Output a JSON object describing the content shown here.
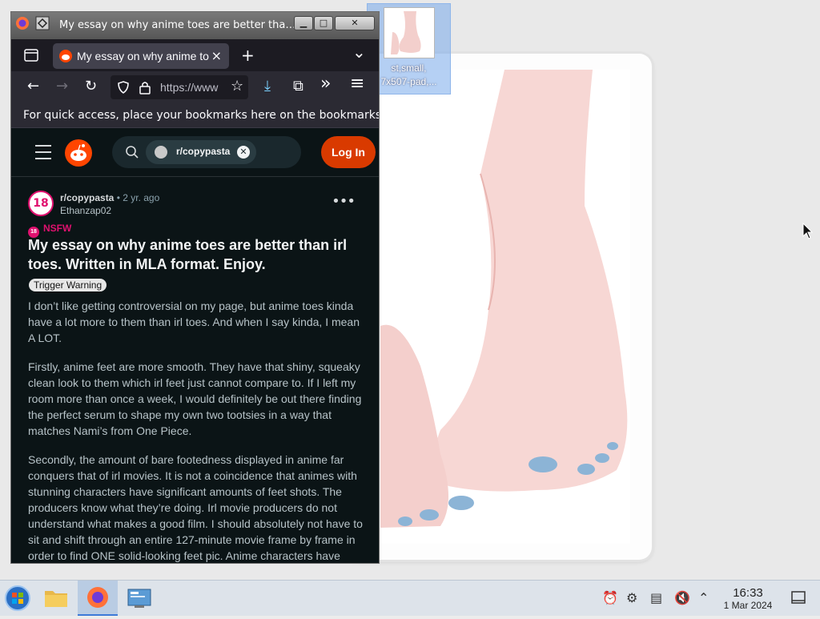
{
  "window": {
    "title": "My essay on why anime toes are better than ..."
  },
  "tab": {
    "label": "My essay on why anime toes",
    "close": "×",
    "new": "+",
    "list": "⌄"
  },
  "nav": {
    "back": "←",
    "forward": "→",
    "reload": "↻",
    "url": "https://www",
    "star": "☆",
    "download": "⤓",
    "extensions": "⧉",
    "overflow": "»",
    "menu": "≡"
  },
  "bookmarks_bar": {
    "text": "For quick access, place your bookmarks here on the bookmarks to"
  },
  "reddit": {
    "search_chip": "r/copypasta",
    "login": "Log In",
    "subreddit": "r/copypasta",
    "separator": "•",
    "age": "2 yr. ago",
    "author": "Ethanzap02",
    "avatar_text": "18",
    "nsfw": "NSFW",
    "nsfw_badge": "18",
    "more": "•••",
    "title": "My essay on why anime toes are better than irl toes. Written in MLA format. Enjoy.",
    "flair": "Trigger Warning",
    "paragraphs": [
      "I don’t like getting controversial on my page, but anime toes kinda have a lot more to them than irl toes. And when I say kinda, I mean A LOT.",
      "Firstly, anime feet are more smooth. They have that shiny, squeaky clean look to them which irl feet just cannot compare to. If I left my room more than once a week, I would definitely be out there finding the perfect serum to shape my own two tootsies in a way that matches Nami’s from One Piece.",
      "Secondly, the amount of bare footedness displayed in anime far conquers that of irl movies. It is not a coincidence that animes with stunning characters have significant amounts of feet shots. The producers know what they’re doing. Irl movie producers do not understand what makes a good film. I should absolutely not have to sit and shift through an entire 127-minute movie frame by frame in order to find ONE solid-looking feet pic. Anime characters have"
    ]
  },
  "desktop_icon": {
    "caption": "st,small,\n7x507-pad,..."
  },
  "taskbar": {
    "time": "16:33",
    "date": "1 Mar 2024"
  },
  "colors": {
    "reddit_bg": "#0b1416",
    "login_orange": "#d93a00",
    "nsfw_pink": "#e0116f",
    "firefox_tab": "#42414d"
  }
}
